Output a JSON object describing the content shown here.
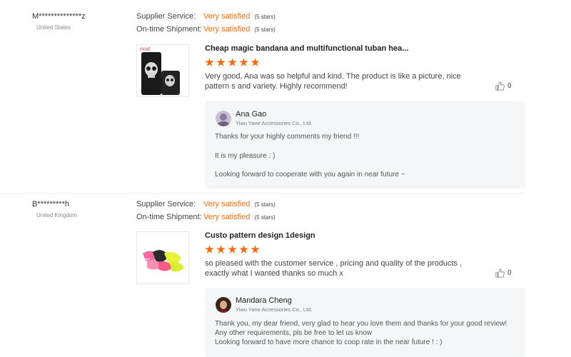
{
  "reviews": [
    {
      "buyer": "M**************z",
      "country": "United States",
      "supplier_service_label": "Supplier Service:",
      "supplier_service_value": "Very satisfied",
      "supplier_service_stars": "(5 stars)",
      "shipment_label": "On-time Shipment:",
      "shipment_value": "Very satisfied",
      "shipment_stars": "(5 stars)",
      "thumb_brand": "YANE",
      "product_title": "Cheap magic bandana and multifunctional tuban hea...",
      "rating": 5,
      "text": "Very good, Ana was so helpful and kind.  The product is like a picture, nice pattern s and variety.  Highly recommend!",
      "likes": "0",
      "reply": {
        "name": "Ana Gao",
        "company": "Yiwu Yane Accessories Co., Ltd.",
        "lines": [
          "Thanks for your highly comments my friend !!!",
          "It is my pleasure : )",
          "Looking forward to cooperate with you again in near future ~"
        ]
      }
    },
    {
      "buyer": "B*********h",
      "country": "United Kingdom",
      "supplier_service_label": "Supplier Service:",
      "supplier_service_value": "Very satisfied",
      "supplier_service_stars": "(5 stars)",
      "shipment_label": "On-time Shipment:",
      "shipment_value": "Very satisfied",
      "shipment_stars": "(5 stars)",
      "product_title": "Custo pattern design 1design",
      "rating": 5,
      "text": "so pleased with the customer service , pricing and quality of the products , exactly what I wanted thanks so much x",
      "likes": "0",
      "reply": {
        "name": "Mandara Cheng",
        "company": "Yiwu Yane Accessories Co., Ltd.",
        "lines": [
          "Thank you, my dear friend, very glad to hear you love them and thanks for your good review!",
          "Any other requirements, pls be free to let us know",
          "Looking forward to have more chance to coop rate in the near future !   : )"
        ]
      }
    }
  ],
  "colors": {
    "accent": "#ff6a00",
    "reply_bg": "#f5f6f8"
  },
  "icons": {
    "like": "thumbs-up-icon",
    "star": "star-icon"
  }
}
